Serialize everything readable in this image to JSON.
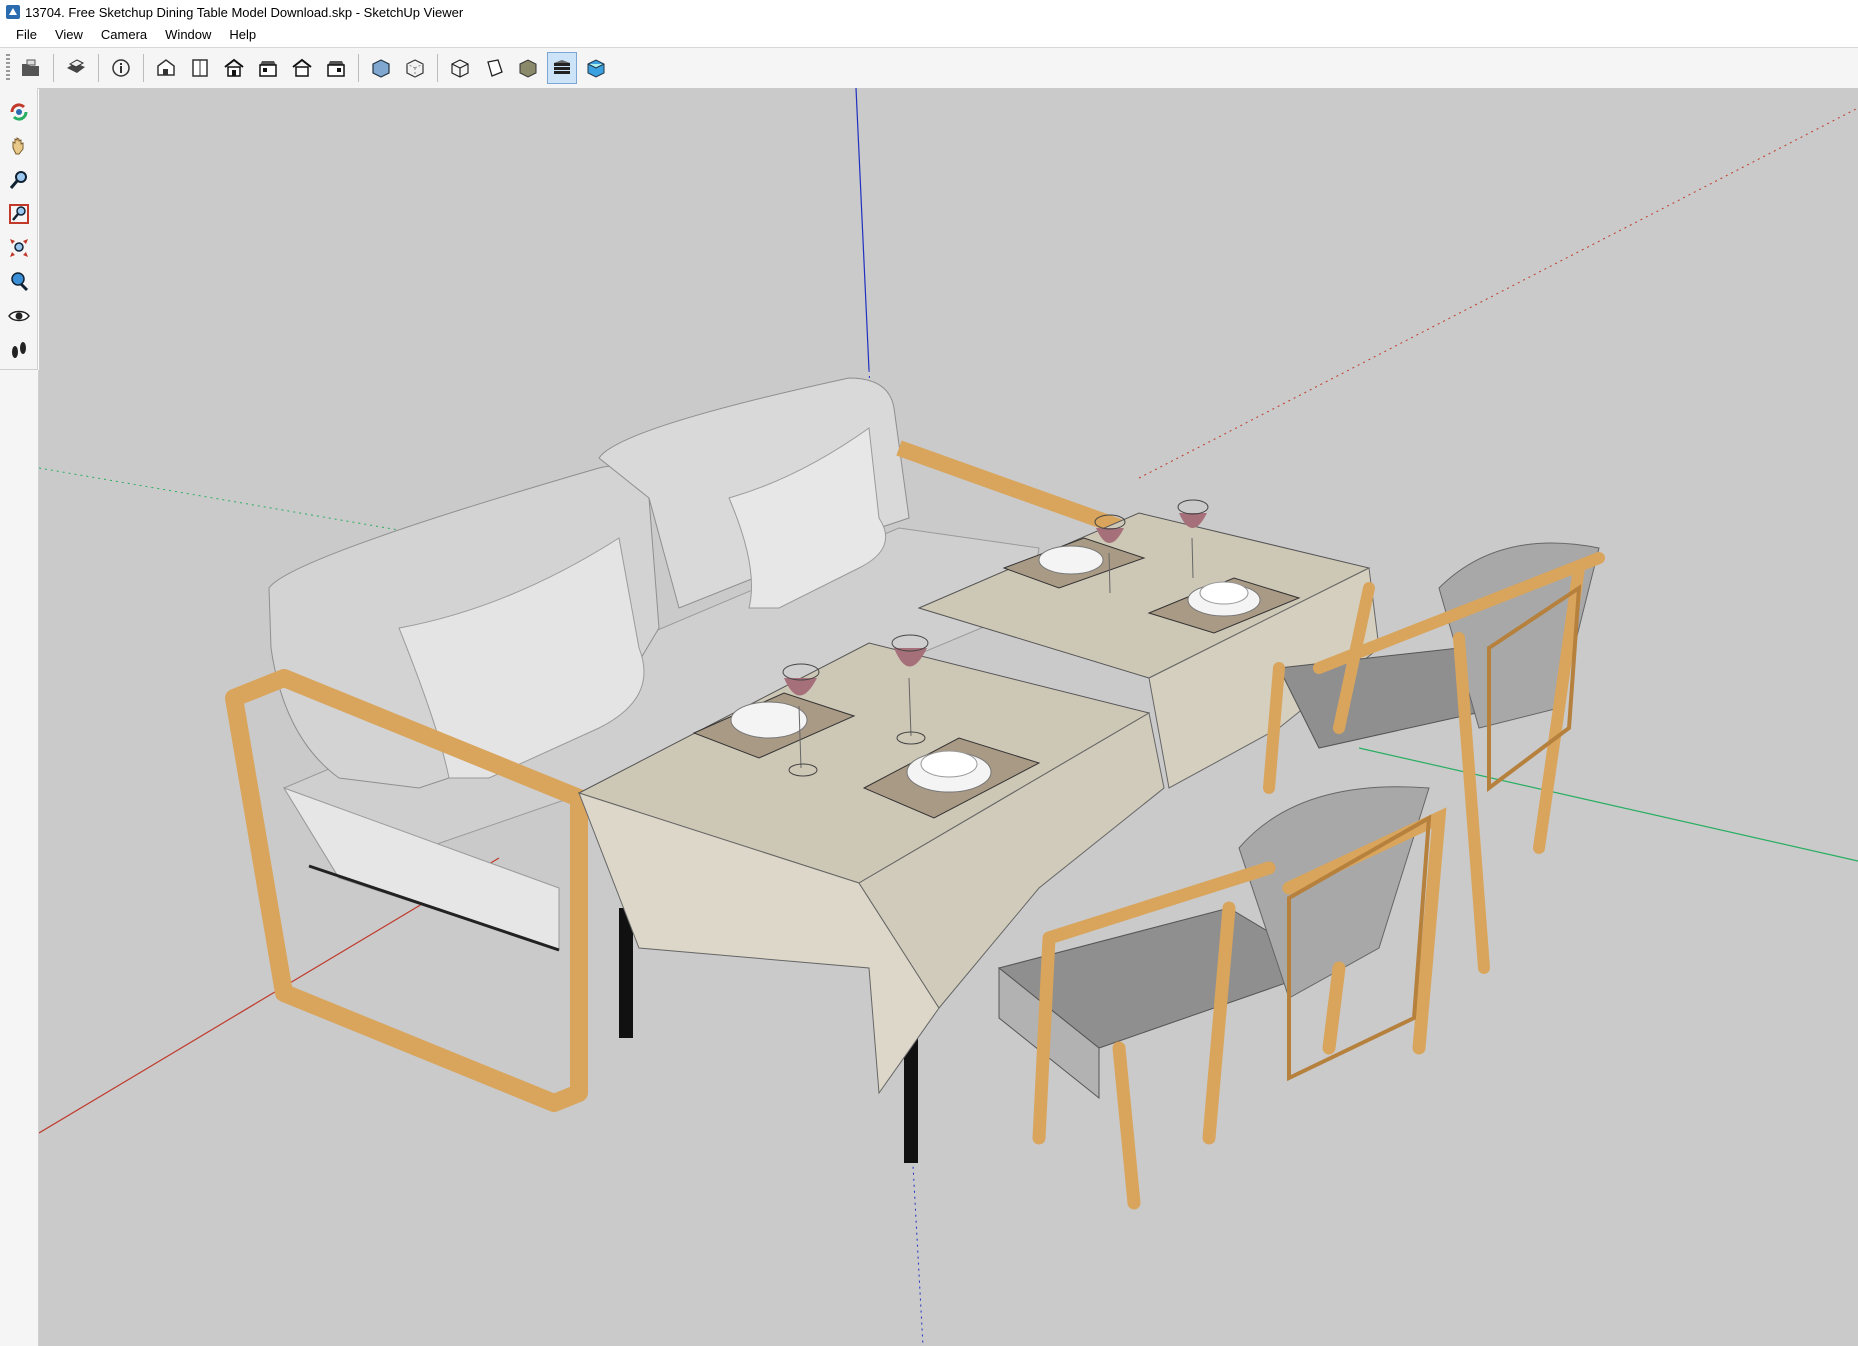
{
  "window": {
    "title": "13704. Free Sketchup Dining Table Model Download.skp - SketchUp Viewer"
  },
  "menu": {
    "items": [
      "File",
      "View",
      "Camera",
      "Window",
      "Help"
    ]
  },
  "toolbar": {
    "buttons": [
      {
        "icon": "open-icon"
      },
      {
        "icon": "print-icon"
      },
      {
        "icon": "model-info-icon"
      },
      {
        "icon": "iso-view-icon"
      },
      {
        "icon": "top-view-icon"
      },
      {
        "icon": "front-view-icon"
      },
      {
        "icon": "right-view-icon"
      },
      {
        "icon": "back-view-icon"
      },
      {
        "icon": "left-view-icon"
      },
      {
        "icon": "xray-icon"
      },
      {
        "icon": "back-edges-icon"
      },
      {
        "icon": "wireframe-icon"
      },
      {
        "icon": "hidden-line-icon"
      },
      {
        "icon": "shaded-icon"
      },
      {
        "icon": "shaded-textures-icon",
        "active": true
      },
      {
        "icon": "monochrome-icon"
      }
    ]
  },
  "left_tools": [
    {
      "icon": "orbit-icon"
    },
    {
      "icon": "pan-icon"
    },
    {
      "icon": "zoom-icon"
    },
    {
      "icon": "zoom-window-icon"
    },
    {
      "icon": "zoom-extents-icon"
    },
    {
      "icon": "position-camera-icon"
    },
    {
      "icon": "look-around-icon"
    },
    {
      "icon": "walk-icon"
    }
  ],
  "colors": {
    "viewport_bg": "#cacaca",
    "axis_red": "#c0392b",
    "axis_green": "#27ae60",
    "axis_blue": "#2030c0",
    "wood": "#d9a55c",
    "cloth": "#d6d1c3",
    "cushion": "#cfcfcf"
  }
}
